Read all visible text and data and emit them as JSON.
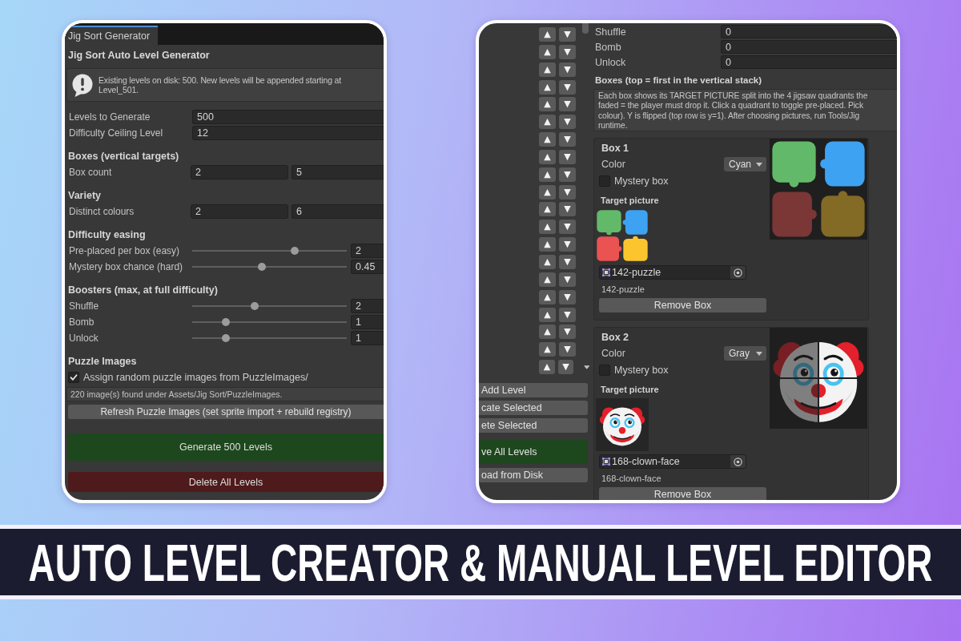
{
  "generator": {
    "tabs": [
      {
        "label": "Jig Sort Generator",
        "selected": true
      }
    ],
    "title": "Jig Sort Auto Level Generator",
    "notice": "Existing levels on disk: 500. New levels will be appended starting at Level_501.",
    "sections": [
      {
        "rows": [
          {
            "kind": "field",
            "label": "Levels to Generate",
            "value": "500"
          },
          {
            "kind": "field",
            "label": "Difficulty Ceiling Level",
            "value": "12"
          }
        ]
      },
      {
        "heading": "Boxes (vertical targets)",
        "rows": [
          {
            "kind": "range",
            "label": "Box count",
            "values": [
              "2",
              "5"
            ]
          }
        ]
      },
      {
        "heading": "Variety",
        "rows": [
          {
            "kind": "range",
            "label": "Distinct colours",
            "values": [
              "2",
              "6"
            ]
          }
        ]
      },
      {
        "heading": "Difficulty easing",
        "rows": [
          {
            "kind": "slider",
            "label": "Pre-placed per box (easy)",
            "level": 0.67,
            "value": "2"
          },
          {
            "kind": "slider",
            "label": "Mystery box chance (hard)",
            "level": 0.45,
            "value": "0.45"
          }
        ]
      },
      {
        "heading": "Boosters (max, at full difficulty)",
        "rows": [
          {
            "kind": "slider",
            "label": "Shuffle",
            "level": 0.4,
            "value": "2"
          },
          {
            "kind": "slider",
            "label": "Bomb",
            "level": 0.2,
            "value": "1"
          },
          {
            "kind": "slider",
            "label": "Unlock",
            "level": 0.2,
            "value": "1"
          }
        ]
      },
      {
        "heading": "Puzzle Images",
        "rows": [
          {
            "kind": "checkbox",
            "label": "Assign random puzzle images from PuzzleImages/",
            "checked": true
          },
          {
            "kind": "note",
            "text": "220 image(s) found under Assets/Jig Sort/PuzzleImages."
          },
          {
            "kind": "button",
            "label": "Refresh Puzzle Images (set sprite import + rebuild registry)"
          }
        ]
      }
    ],
    "actions": [
      {
        "kind": "primary",
        "label": "Generate 500 Levels"
      },
      {
        "kind": "danger",
        "label": "Delete All Levels"
      }
    ]
  },
  "editor": {
    "reorder_rows": [
      {
        "up": "▲",
        "down": "▼"
      },
      {
        "up": "▲",
        "down": "▼"
      },
      {
        "up": "▲",
        "down": "▼"
      },
      {
        "up": "▲",
        "down": "▼"
      },
      {
        "up": "▲",
        "down": "▼"
      },
      {
        "up": "▲",
        "down": "▼"
      },
      {
        "up": "▲",
        "down": "▼"
      },
      {
        "up": "▲",
        "down": "▼"
      },
      {
        "up": "▲",
        "down": "▼"
      },
      {
        "up": "▲",
        "down": "▼"
      },
      {
        "up": "▲",
        "down": "▼"
      },
      {
        "up": "▲",
        "down": "▼"
      },
      {
        "up": "▲",
        "down": "▼"
      },
      {
        "up": "▲",
        "down": "▼"
      },
      {
        "up": "▲",
        "down": "▼"
      },
      {
        "up": "▲",
        "down": "▼"
      },
      {
        "up": "▲",
        "down": "▼"
      },
      {
        "up": "▲",
        "down": "▼"
      },
      {
        "up": "▲",
        "down": "▼"
      },
      {
        "up": "▲",
        "down": "▼"
      }
    ],
    "level_buttons": [
      {
        "kind": "plain",
        "label": "Add Level"
      },
      {
        "kind": "plain",
        "label": "cate Selected"
      },
      {
        "kind": "plain",
        "label": "ete Selected"
      },
      {
        "kind": "primary",
        "label": "ve All Levels"
      },
      {
        "kind": "plain",
        "label": "oad from Disk"
      }
    ],
    "booster_fields": [
      {
        "label": "Shuffle",
        "value": "0"
      },
      {
        "label": "Bomb",
        "value": "0"
      },
      {
        "label": "Unlock",
        "value": "0"
      }
    ],
    "boxes_heading": "Boxes (top = first in the vertical stack)",
    "boxes_help": "Each box shows its TARGET PICTURE split into the 4 jigsaw quadrants the\nfaded = the player must drop it. Click a quadrant to toggle pre-placed. Pick\ncolour). Y is flipped (top row is y=1). After choosing pictures, run Tools/Jig\nruntime.",
    "boxes": [
      {
        "kind": "puzzle",
        "title": "Box 1",
        "color_label": "Color",
        "color_value": "Cyan",
        "mystery_label": "Mystery box",
        "mystery": false,
        "target_label": "Target picture",
        "sprite": "142-puzzle",
        "caption": "142-puzzle",
        "remove_label": "Remove Box",
        "quadrants": [
          {
            "placed": true
          },
          {
            "placed": true
          },
          {
            "placed": false
          },
          {
            "placed": false
          }
        ]
      },
      {
        "kind": "clown",
        "title": "Box 2",
        "color_label": "Color",
        "color_value": "Gray",
        "mystery_label": "Mystery box",
        "mystery": false,
        "target_label": "Target picture",
        "sprite": "168-clown-face",
        "caption": "168-clown-face",
        "remove_label": "Remove Box",
        "quadrants": [
          {
            "placed": false
          },
          {
            "placed": true
          },
          {
            "placed": false
          },
          {
            "placed": true
          }
        ]
      }
    ]
  },
  "banner": {
    "title": "AUTO LEVEL CREATOR & MANUAL LEVEL EDITOR"
  }
}
